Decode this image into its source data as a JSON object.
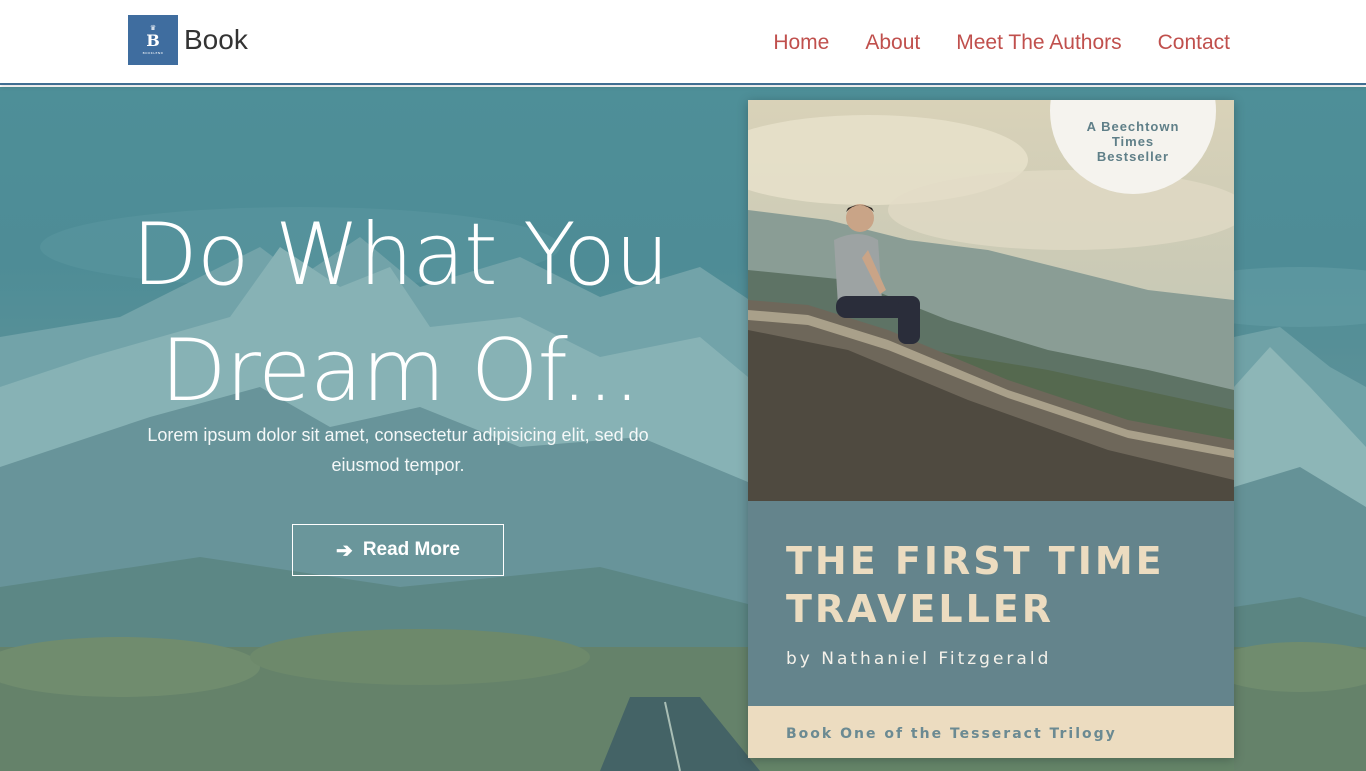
{
  "navbar": {
    "logo": {
      "letter": "B",
      "caption": "BOOKLEND",
      "icon": "book-logo-icon"
    },
    "brand_name": "Book",
    "links": [
      {
        "label": "Home"
      },
      {
        "label": "About"
      },
      {
        "label": "Meet The Authors"
      },
      {
        "label": "Contact"
      }
    ],
    "link_color": "#c0504d",
    "accent_color": "#3f6d9f"
  },
  "hero": {
    "headline_line1": "Do What You",
    "headline_line2": "Dream Of...",
    "subtext": "Lorem ipsum dolor sit amet, consectetur adipisicing elit, sed do eiusmod tempor.",
    "button": {
      "label": "Read More",
      "icon": "arrow-right-icon"
    },
    "background_tint": "#5b97a0"
  },
  "book_cover": {
    "badge": [
      "A Beechtown",
      "Times",
      "Bestseller"
    ],
    "title_line1": "THE FIRST TIME",
    "title_line2": "TRAVELLER",
    "author": "by Nathaniel Fitzgerald",
    "series": "Book One of the Tesseract Trilogy",
    "panel_color": "#64848c",
    "title_color": "#ecdcc0"
  }
}
